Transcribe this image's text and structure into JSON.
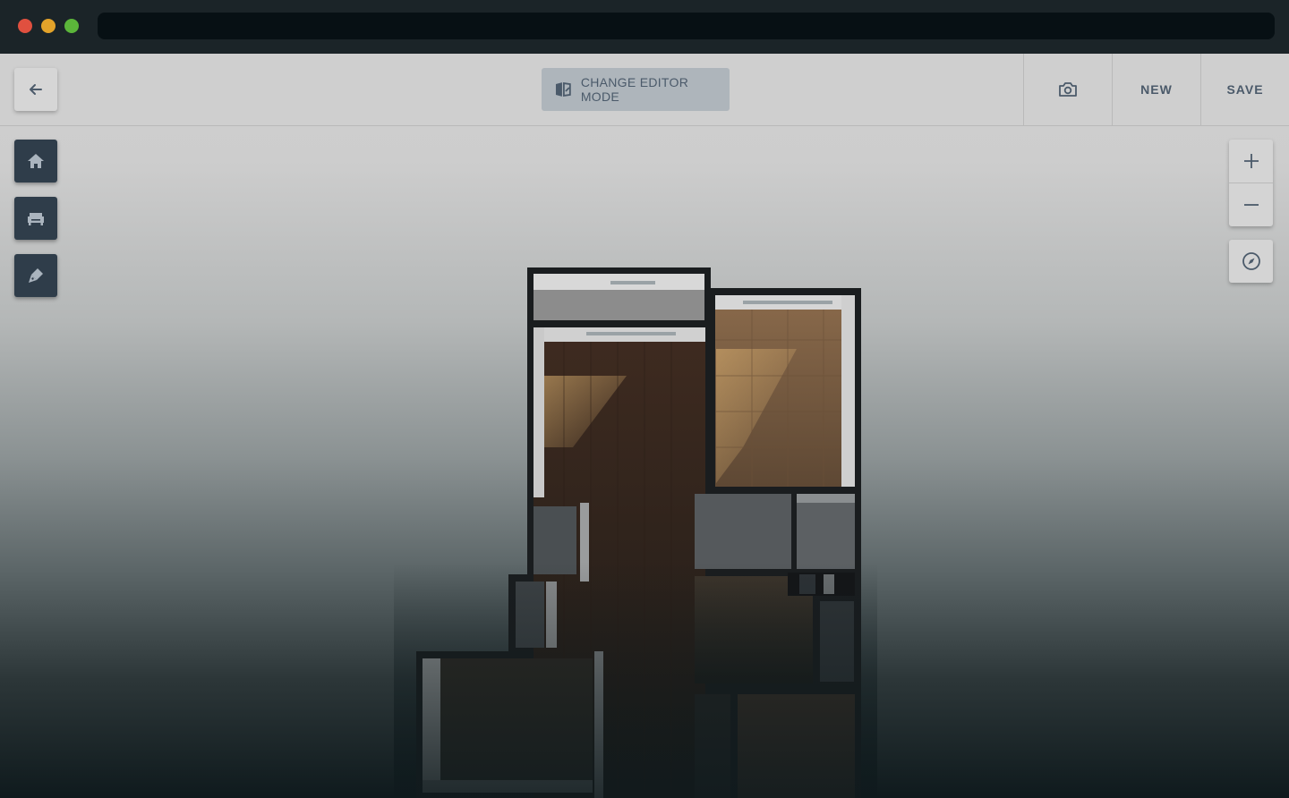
{
  "window": {
    "controls": [
      "close",
      "minimize",
      "maximize"
    ],
    "address": ""
  },
  "toolbar": {
    "back_icon": "arrow-left-icon",
    "mode_label": "CHANGE EDITOR MODE",
    "mode_icon": "editor-mode-icon",
    "camera_icon": "camera-icon",
    "new_label": "NEW",
    "save_label": "SAVE"
  },
  "left_tools": [
    {
      "name": "home-tool",
      "icon": "home-icon"
    },
    {
      "name": "furniture-tool",
      "icon": "sofa-icon"
    },
    {
      "name": "paint-tool",
      "icon": "paint-brush-icon"
    }
  ],
  "zoom": {
    "in_icon": "plus-icon",
    "out_icon": "minus-icon",
    "compass_icon": "compass-icon"
  },
  "colors": {
    "toolbar_bg": "#cfcfcf",
    "tool_bg": "#2f3d4a",
    "accent_text": "#4b5a6a",
    "mode_button_bg": "#aeb5bb",
    "wood_floor": "#3a2a20",
    "tile_floor": "#7a6048"
  }
}
